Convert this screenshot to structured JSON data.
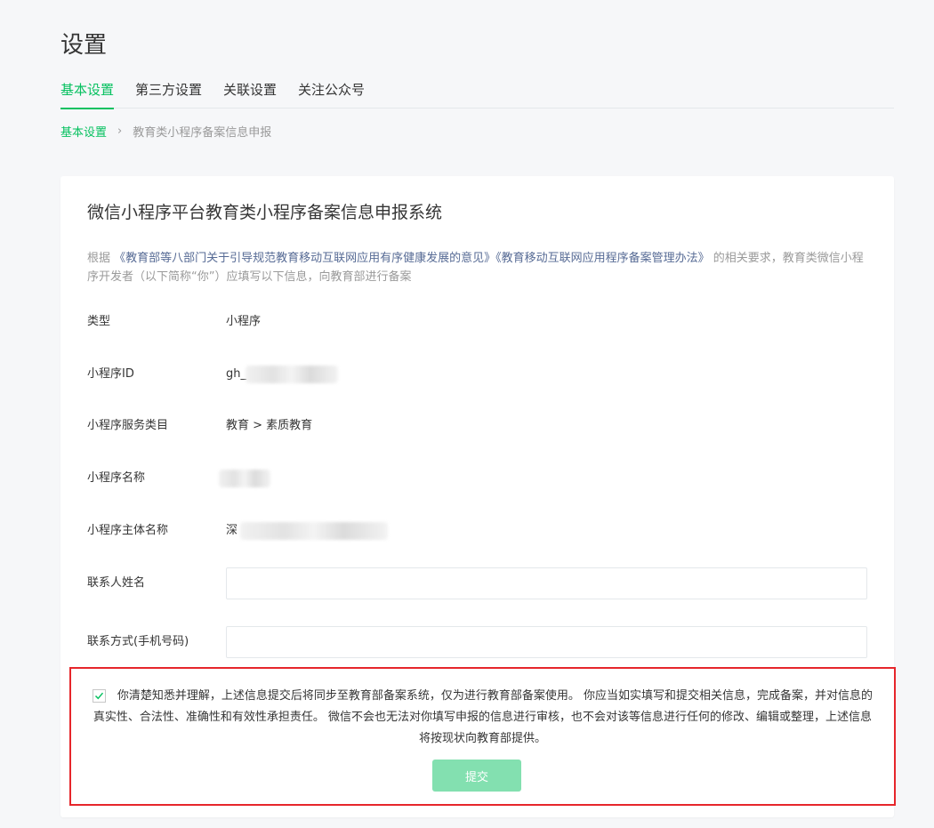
{
  "page": {
    "title": "设置"
  },
  "tabs": [
    {
      "label": "基本设置",
      "active": true
    },
    {
      "label": "第三方设置",
      "active": false
    },
    {
      "label": "关联设置",
      "active": false
    },
    {
      "label": "关注公众号",
      "active": false
    }
  ],
  "breadcrumb": {
    "parent": "基本设置",
    "separator": "›",
    "current": "教育类小程序备案信息申报"
  },
  "card": {
    "title": "微信小程序平台教育类小程序备案信息申报系统",
    "intro_prefix": "根据 ",
    "doc1": "《教育部等八部门关于引导规范教育移动互联网应用有序健康发展的意见》",
    "doc2": "《教育移动互联网应用程序备案管理办法》",
    "intro_suffix": " 的相关要求，教育类微信小程序开发者（以下简称“你”）应填写以下信息，向教育部进行备案"
  },
  "form": {
    "type": {
      "label": "类型",
      "value": "小程序"
    },
    "appid": {
      "label": "小程序ID",
      "value": "gh_"
    },
    "category": {
      "label": "小程序服务类目",
      "value": "教育 > 素质教育"
    },
    "name": {
      "label": "小程序名称",
      "value": ""
    },
    "entity": {
      "label": "小程序主体名称",
      "value": "深"
    },
    "contact_name": {
      "label": "联系人姓名",
      "value": "",
      "placeholder": ""
    },
    "contact_phone": {
      "label": "联系方式(手机号码)",
      "value": "",
      "placeholder": ""
    }
  },
  "agreement": {
    "checked": true,
    "text": "你清楚知悉并理解，上述信息提交后将同步至教育部备案系统，仅为进行教育部备案使用。 你应当如实填写和提交相关信息，完成备案，并对信息的真实性、合法性、准确性和有效性承担责任。 微信不会也无法对你填写申报的信息进行审核，也不会对该等信息进行任何的修改、编辑或整理，上述信息将按现状向教育部提供。",
    "submit_label": "提交"
  },
  "colors": {
    "accent": "#07c160",
    "accent_disabled": "#83e0b0",
    "highlight_border": "#e6262b",
    "link": "#576b95"
  }
}
